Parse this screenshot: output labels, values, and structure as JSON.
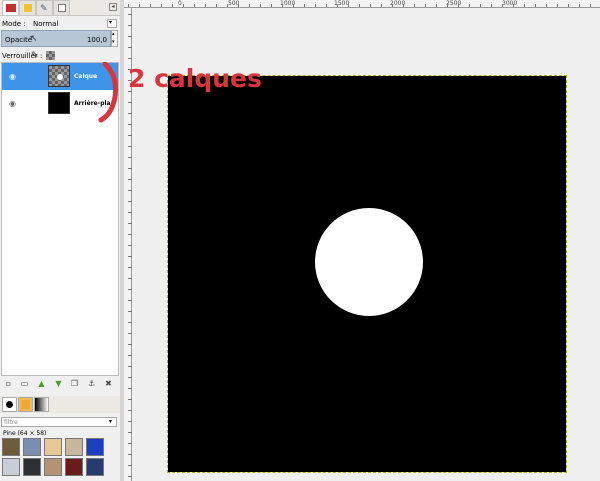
{
  "layers_panel": {
    "mode_label": "Mode :",
    "mode_value": "Normal",
    "opacity_label": "Opacité",
    "opacity_value": "100,0",
    "lock_label": "Verrouiller :",
    "layers": [
      {
        "name": "Calque",
        "selected": true
      },
      {
        "name": "Arrière-plan",
        "selected": false
      }
    ]
  },
  "brushes_panel": {
    "filter_value": "filtre",
    "pattern_label": "Pine (64 × 58)"
  },
  "ruler": {
    "h_labels": [
      "0",
      "500",
      "1000",
      "1500",
      "2000",
      "2500",
      "3000"
    ]
  },
  "annotation": {
    "text": "2 calques",
    "color": "#d8353d"
  },
  "colors": {
    "selected_layer": "#3d94e9",
    "opacity_bar": "#b7c7d6",
    "image_fill": "#000000",
    "circle_fill": "#ffffff"
  }
}
